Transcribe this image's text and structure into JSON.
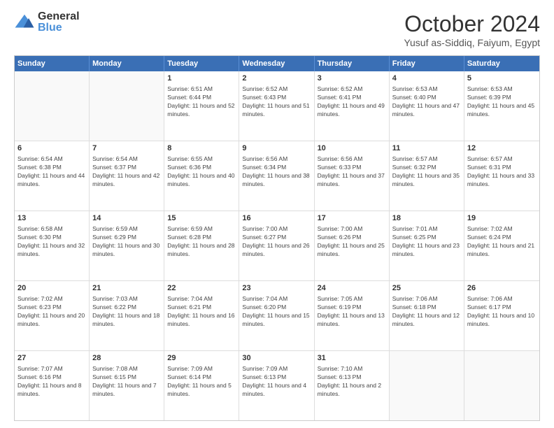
{
  "logo": {
    "general": "General",
    "blue": "Blue"
  },
  "title": "October 2024",
  "subtitle": "Yusuf as-Siddiq, Faiyum, Egypt",
  "days": [
    "Sunday",
    "Monday",
    "Tuesday",
    "Wednesday",
    "Thursday",
    "Friday",
    "Saturday"
  ],
  "weeks": [
    [
      {
        "day": "",
        "empty": true
      },
      {
        "day": "",
        "empty": true
      },
      {
        "day": "1",
        "sunrise": "6:51 AM",
        "sunset": "6:44 PM",
        "daylight": "11 hours and 52 minutes."
      },
      {
        "day": "2",
        "sunrise": "6:52 AM",
        "sunset": "6:43 PM",
        "daylight": "11 hours and 51 minutes."
      },
      {
        "day": "3",
        "sunrise": "6:52 AM",
        "sunset": "6:41 PM",
        "daylight": "11 hours and 49 minutes."
      },
      {
        "day": "4",
        "sunrise": "6:53 AM",
        "sunset": "6:40 PM",
        "daylight": "11 hours and 47 minutes."
      },
      {
        "day": "5",
        "sunrise": "6:53 AM",
        "sunset": "6:39 PM",
        "daylight": "11 hours and 45 minutes."
      }
    ],
    [
      {
        "day": "6",
        "sunrise": "6:54 AM",
        "sunset": "6:38 PM",
        "daylight": "11 hours and 44 minutes."
      },
      {
        "day": "7",
        "sunrise": "6:54 AM",
        "sunset": "6:37 PM",
        "daylight": "11 hours and 42 minutes."
      },
      {
        "day": "8",
        "sunrise": "6:55 AM",
        "sunset": "6:36 PM",
        "daylight": "11 hours and 40 minutes."
      },
      {
        "day": "9",
        "sunrise": "6:56 AM",
        "sunset": "6:34 PM",
        "daylight": "11 hours and 38 minutes."
      },
      {
        "day": "10",
        "sunrise": "6:56 AM",
        "sunset": "6:33 PM",
        "daylight": "11 hours and 37 minutes."
      },
      {
        "day": "11",
        "sunrise": "6:57 AM",
        "sunset": "6:32 PM",
        "daylight": "11 hours and 35 minutes."
      },
      {
        "day": "12",
        "sunrise": "6:57 AM",
        "sunset": "6:31 PM",
        "daylight": "11 hours and 33 minutes."
      }
    ],
    [
      {
        "day": "13",
        "sunrise": "6:58 AM",
        "sunset": "6:30 PM",
        "daylight": "11 hours and 32 minutes."
      },
      {
        "day": "14",
        "sunrise": "6:59 AM",
        "sunset": "6:29 PM",
        "daylight": "11 hours and 30 minutes."
      },
      {
        "day": "15",
        "sunrise": "6:59 AM",
        "sunset": "6:28 PM",
        "daylight": "11 hours and 28 minutes."
      },
      {
        "day": "16",
        "sunrise": "7:00 AM",
        "sunset": "6:27 PM",
        "daylight": "11 hours and 26 minutes."
      },
      {
        "day": "17",
        "sunrise": "7:00 AM",
        "sunset": "6:26 PM",
        "daylight": "11 hours and 25 minutes."
      },
      {
        "day": "18",
        "sunrise": "7:01 AM",
        "sunset": "6:25 PM",
        "daylight": "11 hours and 23 minutes."
      },
      {
        "day": "19",
        "sunrise": "7:02 AM",
        "sunset": "6:24 PM",
        "daylight": "11 hours and 21 minutes."
      }
    ],
    [
      {
        "day": "20",
        "sunrise": "7:02 AM",
        "sunset": "6:23 PM",
        "daylight": "11 hours and 20 minutes."
      },
      {
        "day": "21",
        "sunrise": "7:03 AM",
        "sunset": "6:22 PM",
        "daylight": "11 hours and 18 minutes."
      },
      {
        "day": "22",
        "sunrise": "7:04 AM",
        "sunset": "6:21 PM",
        "daylight": "11 hours and 16 minutes."
      },
      {
        "day": "23",
        "sunrise": "7:04 AM",
        "sunset": "6:20 PM",
        "daylight": "11 hours and 15 minutes."
      },
      {
        "day": "24",
        "sunrise": "7:05 AM",
        "sunset": "6:19 PM",
        "daylight": "11 hours and 13 minutes."
      },
      {
        "day": "25",
        "sunrise": "7:06 AM",
        "sunset": "6:18 PM",
        "daylight": "11 hours and 12 minutes."
      },
      {
        "day": "26",
        "sunrise": "7:06 AM",
        "sunset": "6:17 PM",
        "daylight": "11 hours and 10 minutes."
      }
    ],
    [
      {
        "day": "27",
        "sunrise": "7:07 AM",
        "sunset": "6:16 PM",
        "daylight": "11 hours and 8 minutes."
      },
      {
        "day": "28",
        "sunrise": "7:08 AM",
        "sunset": "6:15 PM",
        "daylight": "11 hours and 7 minutes."
      },
      {
        "day": "29",
        "sunrise": "7:09 AM",
        "sunset": "6:14 PM",
        "daylight": "11 hours and 5 minutes."
      },
      {
        "day": "30",
        "sunrise": "7:09 AM",
        "sunset": "6:13 PM",
        "daylight": "11 hours and 4 minutes."
      },
      {
        "day": "31",
        "sunrise": "7:10 AM",
        "sunset": "6:13 PM",
        "daylight": "11 hours and 2 minutes."
      },
      {
        "day": "",
        "empty": true
      },
      {
        "day": "",
        "empty": true
      }
    ]
  ]
}
